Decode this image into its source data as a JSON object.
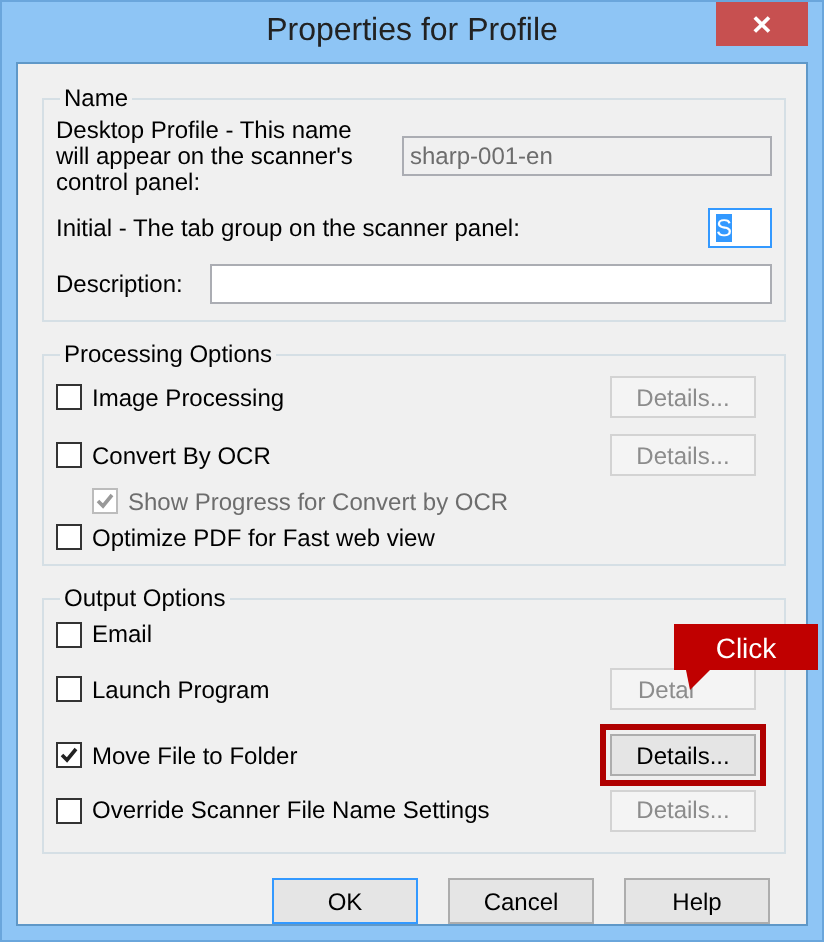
{
  "window": {
    "title": "Properties for Profile",
    "close": "✕"
  },
  "name_group": {
    "legend": "Name",
    "profile_label": "Desktop Profile - This name will appear on the scanner's control panel:",
    "profile_value": "sharp-001-en",
    "profile_disabled": true,
    "initial_label": "Initial - The tab group on the scanner panel:",
    "initial_value": "S",
    "initial_selected": true,
    "description_label": "Description:"
  },
  "processing_options": {
    "legend": "Processing Options",
    "items": [
      {
        "label": "Image Processing",
        "checked": false,
        "details": {
          "label": "Details...",
          "disabled": true,
          "highlighted": false
        }
      },
      {
        "label": "Convert By OCR",
        "checked": false,
        "details": {
          "label": "Details...",
          "disabled": true,
          "highlighted": false
        },
        "children": [
          {
            "label": "Show Progress for Convert by OCR",
            "checked": true,
            "disabled": true
          }
        ]
      },
      {
        "label": "Optimize PDF for Fast web view",
        "checked": false
      }
    ]
  },
  "output_options": {
    "legend": "Output Options",
    "items": [
      {
        "label": "Email",
        "checked": false
      },
      {
        "label": "Launch Program",
        "checked": false,
        "details": {
          "label": "Detai",
          "disabled": true,
          "highlighted": false
        }
      },
      {
        "label": "Move File to Folder",
        "checked": true,
        "details": {
          "label": "Details...",
          "disabled": false,
          "highlighted": true
        }
      },
      {
        "label": "Override Scanner File Name Settings",
        "checked": false,
        "details": {
          "label": "Details...",
          "disabled": true,
          "highlighted": false
        }
      }
    ]
  },
  "callout": {
    "text": "Click"
  },
  "buttons": [
    {
      "label": "OK",
      "default": true
    },
    {
      "label": "Cancel",
      "default": false
    },
    {
      "label": "Help",
      "default": false
    }
  ]
}
